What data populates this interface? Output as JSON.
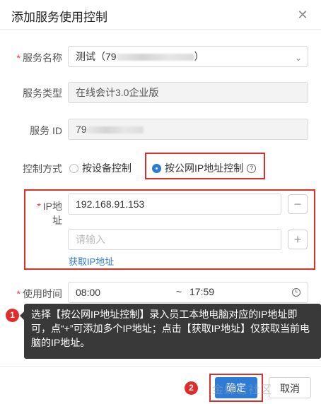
{
  "dialog": {
    "title": "添加服务使用控制",
    "close": "✕"
  },
  "form": {
    "service_name": {
      "label": "服务名称",
      "value": "测试（79",
      "suffix": "）"
    },
    "service_type": {
      "label": "服务类型",
      "value": "在线会计3.0企业版"
    },
    "service_id": {
      "label": "服务 ID",
      "value": "79"
    },
    "control_mode": {
      "label": "控制方式",
      "options": [
        "按设备控制",
        "按公网IP地址控制"
      ],
      "selected": "按公网IP地址控制"
    },
    "ip": {
      "label": "IP地址",
      "value": "192.168.91.153",
      "placeholder": "请输入",
      "minus": "−",
      "plus": "+",
      "fetch_link": "获取IP地址"
    },
    "use_time": {
      "label": "使用时间",
      "start": "08:00",
      "separator": "~",
      "end": "17:59"
    }
  },
  "annotations": {
    "badge1": "1",
    "badge2": "2",
    "tooltip": "选择【按公网IP地址控制】录入员工本地电脑对应的IP地址即可，点“+”可添加多个IP地址；点击【获取IP地址】仅获取当前电脑的IP地址。"
  },
  "footer": {
    "confirm": "确定",
    "cancel": "取消"
  },
  "watermark": "金蝶云社区",
  "colors": {
    "accent": "#2e7bd6",
    "highlight": "#d9302d",
    "required": "#e53e3e"
  }
}
